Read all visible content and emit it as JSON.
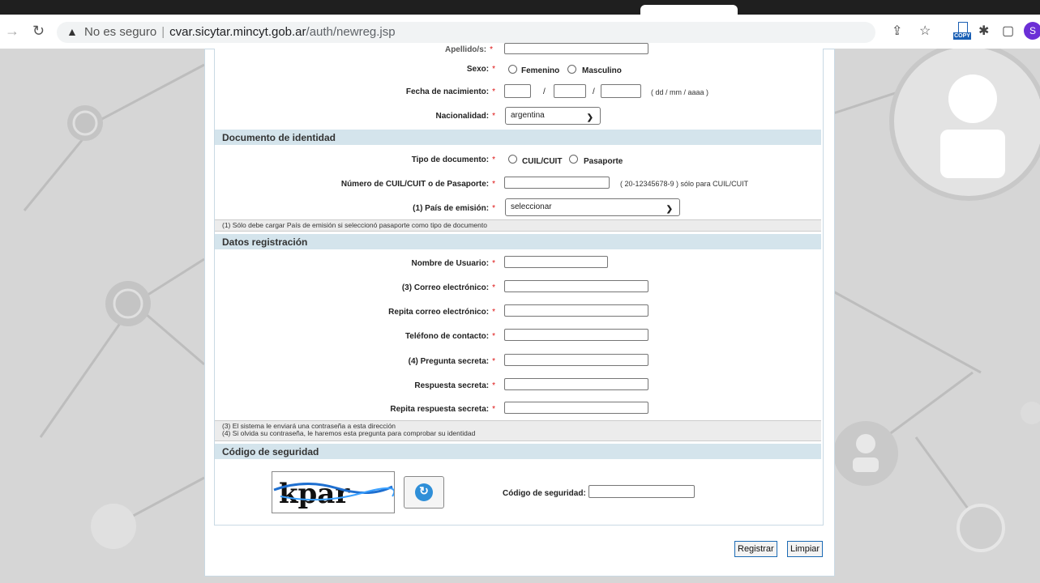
{
  "browser": {
    "security_label": "No es seguro",
    "url_host": "cvar.sicytar.mincyt.gob.ar",
    "url_path": "/auth/newreg.jsp",
    "copy_badge": "COPY",
    "profile_initial": "S"
  },
  "personal": {
    "apellido_label": "Apellido/s:",
    "sexo_label": "Sexo:",
    "sexo_options": [
      "Femenino",
      "Masculino"
    ],
    "fecha_label": "Fecha de nacimiento:",
    "fecha_sep": "/",
    "fecha_hint": "( dd / mm / aaaa )",
    "nacionalidad_label": "Nacionalidad:",
    "nacionalidad_value": "argentina"
  },
  "documento": {
    "section_title": "Documento de identidad",
    "tipo_label": "Tipo de documento:",
    "tipo_options": [
      "CUIL/CUIT",
      "Pasaporte"
    ],
    "numero_label": "Número de CUIL/CUIT o de Pasaporte:",
    "numero_hint": "( 20-12345678-9 ) sólo para CUIL/CUIT",
    "pais_label": "(1) País de emisión:",
    "pais_value": "seleccionar",
    "note": "(1) Sólo debe cargar País de emisión si seleccionó pasaporte como tipo de documento"
  },
  "registro": {
    "section_title": "Datos registración",
    "usuario_label": "Nombre de Usuario:",
    "correo_label": "(3) Correo electrónico:",
    "repita_correo_label": "Repita correo electrónico:",
    "telefono_label": "Teléfono de contacto:",
    "pregunta_label": "(4) Pregunta secreta:",
    "respuesta_label": "Respuesta secreta:",
    "repita_respuesta_label": "Repita respuesta secreta:",
    "note1": "(3) El sistema le enviará una contraseña a esta dirección",
    "note2": "(4) Si olvida su contraseña, le haremos esta pregunta para comprobar su identidad"
  },
  "seguridad": {
    "section_title": "Código de seguridad",
    "captcha_text": "kpar",
    "codigo_label": "Código de seguridad:"
  },
  "actions": {
    "registrar": "Registrar",
    "limpiar": "Limpiar"
  },
  "required_mark": "*"
}
